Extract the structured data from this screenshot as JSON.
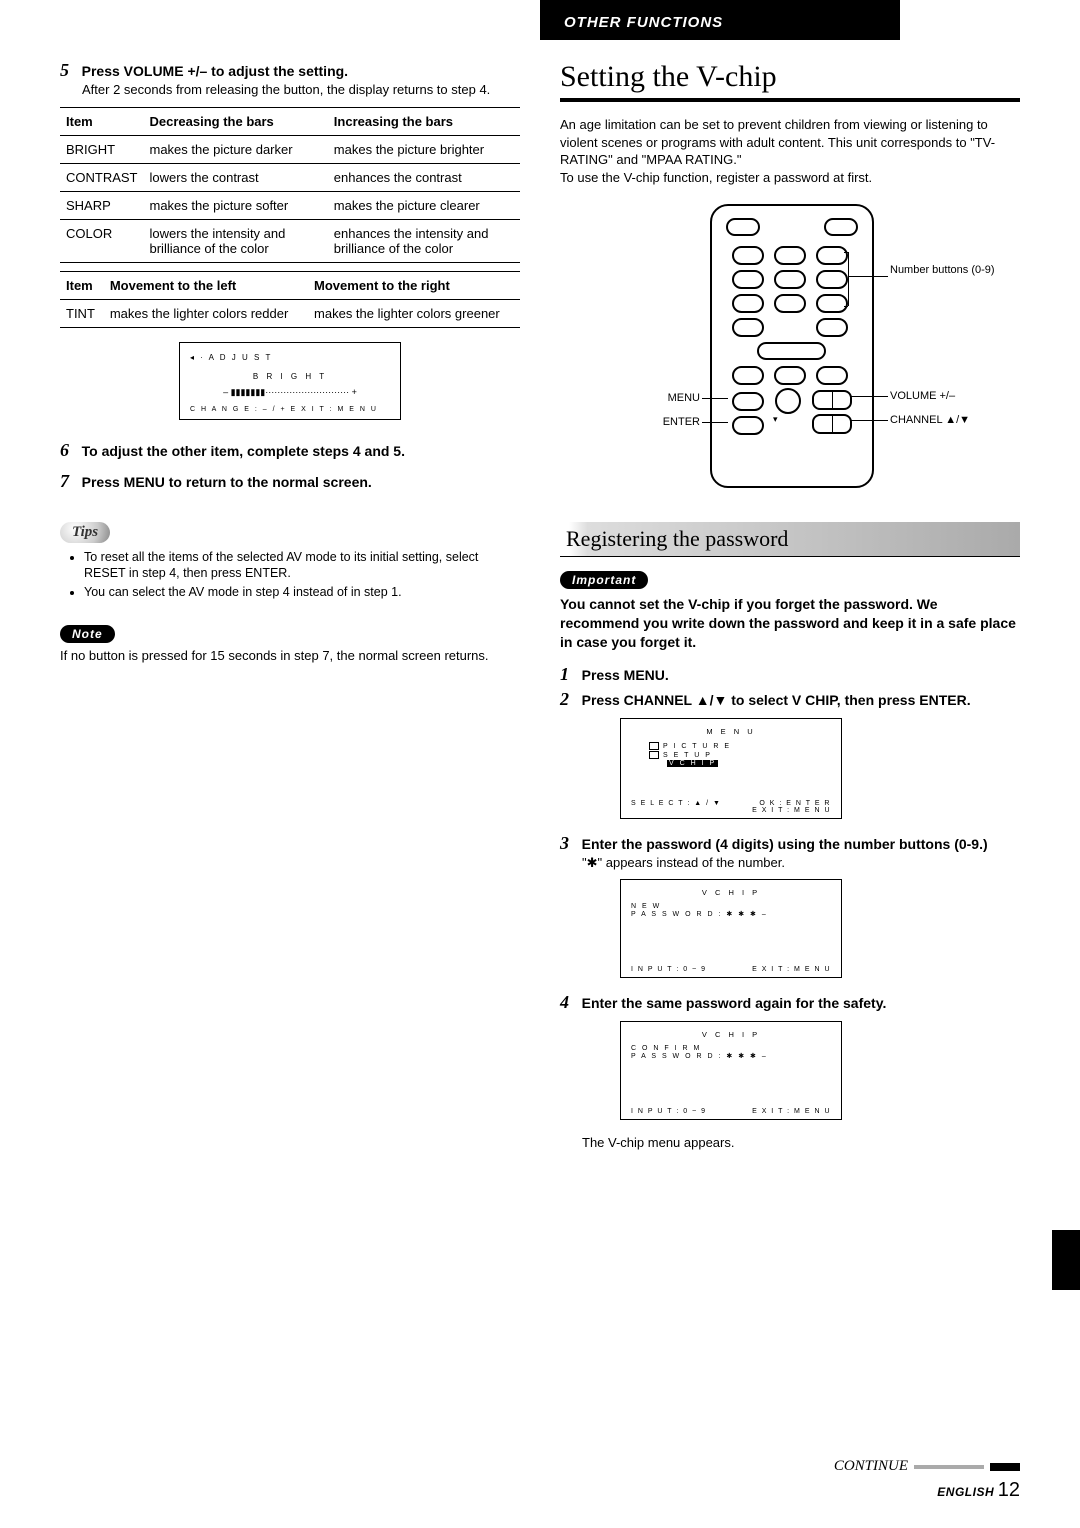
{
  "header": {
    "section": "OTHER FUNCTIONS"
  },
  "left": {
    "step5": {
      "num": "5",
      "title": "Press VOLUME +/– to adjust the setting.",
      "body": "After 2 seconds from releasing the button, the display returns to step 4."
    },
    "table1": {
      "headers": [
        "Item",
        "Decreasing the bars",
        "Increasing the bars"
      ],
      "rows": [
        [
          "BRIGHT",
          "makes the picture darker",
          "makes the picture brighter"
        ],
        [
          "CONTRAST",
          "lowers the contrast",
          "enhances the contrast"
        ],
        [
          "SHARP",
          "makes the picture softer",
          "makes the picture clearer"
        ],
        [
          "COLOR",
          "lowers the intensity and brilliance of the color",
          "enhances the intensity and brilliance of the color"
        ]
      ]
    },
    "table2": {
      "headers": [
        "Item",
        "Movement to the left",
        "Movement to the right"
      ],
      "rows": [
        [
          "TINT",
          "makes the lighter colors redder",
          "makes the lighter colors greener"
        ]
      ]
    },
    "osd1": {
      "top_left": "◂ ·   A D J U S T",
      "center": "B R I G H T",
      "bar": "–   ▮▮▮▮▮▮▮····························   +",
      "footer": "C H A N G E : – / +       E X I T : M E N U"
    },
    "step6": {
      "num": "6",
      "title": "To adjust the other item, complete steps 4 and 5."
    },
    "step7": {
      "num": "7",
      "title": "Press MENU to return to the normal screen."
    },
    "tips": {
      "label": "Tips",
      "items": [
        "To reset all the items of the selected AV mode to its initial setting, select RESET in step 4, then press ENTER.",
        "You can select the AV mode in step 4 instead of in step 1."
      ]
    },
    "note": {
      "label": "Note",
      "text": "If no button is pressed for 15 seconds in step 7, the normal screen returns."
    }
  },
  "right": {
    "h1": "Setting the V-chip",
    "intro": "An age limitation can be set to prevent children from viewing or listening  to violent scenes or programs with adult content.  This unit corresponds to \"TV-RATING\" and \"MPAA RATING.\"\nTo use the V-chip function, register a password at first.",
    "remote_labels": {
      "number": "Number buttons (0-9)",
      "menu": "MENU",
      "enter": "ENTER",
      "volume": "VOLUME +/–",
      "channel": "CHANNEL ▲/▼"
    },
    "h2": "Registering the password",
    "important": {
      "label": "Important",
      "text": "You cannot set the V-chip if you forget the password.  We recommend you write down the password and keep it in a safe place in case you forget it."
    },
    "step1": {
      "num": "1",
      "title": "Press MENU."
    },
    "step2": {
      "num": "2",
      "title": "Press CHANNEL ▲/▼ to select V CHIP, then press ENTER."
    },
    "menu1": {
      "title": "M E N U",
      "items": [
        "P I C T U R E",
        "S E T   U P",
        "V   C H I P"
      ],
      "highlight_index": 2,
      "footer_left": "S E L E C T : ▲ / ▼",
      "footer_right_top": "O K : E N T E R",
      "footer_right_bot": "E X I T : M E N U"
    },
    "step3": {
      "num": "3",
      "title": "Enter the password (4 digits) using the number buttons (0-9.)",
      "sub": "\"✱\"  appears instead of the number."
    },
    "menu2": {
      "title": "V   C H I P",
      "line1": "N E W",
      "line2": "P A S S W O R D       : ✱ ✱ ✱ –",
      "footer_left": "I N P U T : 0 ~ 9",
      "footer_right": "E X I T : M E N U"
    },
    "step4": {
      "num": "4",
      "title": "Enter the same password again for the safety."
    },
    "menu3": {
      "title": "V   C H I P",
      "line1": "C O N F I R M",
      "line2": "P A S S W O R D       : ✱ ✱ ✱ –",
      "footer_left": "I N P U T : 0 ~ 9",
      "footer_right": "E X I T : M E N U"
    },
    "after4": "The V-chip menu appears."
  },
  "footer": {
    "continue": "CONTINUE",
    "language": "ENGLISH",
    "page": "12"
  }
}
